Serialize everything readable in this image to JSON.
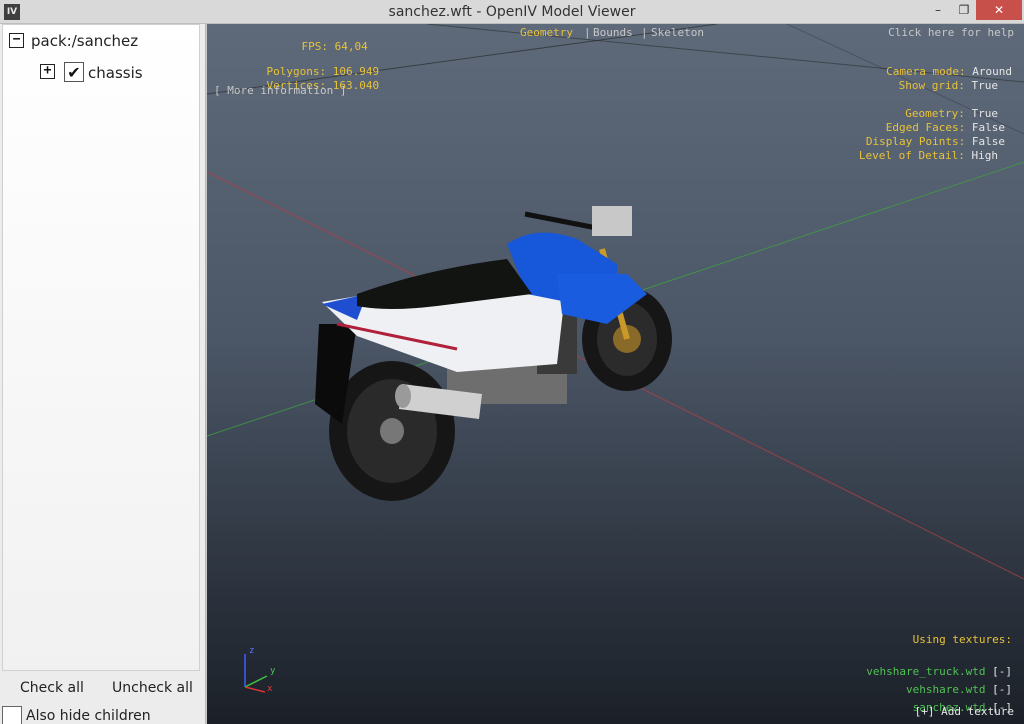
{
  "window": {
    "title": "sanchez.wft - OpenIV Model Viewer",
    "app_icon": "IV",
    "controls": {
      "minimize": "–",
      "maximize": "❐",
      "close": "✕"
    }
  },
  "tree": {
    "root": {
      "expander": "−",
      "label": "pack:/sanchez"
    },
    "child": {
      "expander": "+",
      "checked": "✔",
      "label": "chassis"
    }
  },
  "buttons": {
    "check_all": "Check all",
    "uncheck_all": "Uncheck all"
  },
  "also_hide_children": "Also hide children",
  "hud": {
    "fps": {
      "label": "FPS:",
      "value": "64,04"
    },
    "polygons": {
      "label": "Polygons:",
      "value": "106.949"
    },
    "vertices": {
      "label": "Vertices:",
      "value": "163.040"
    },
    "more_info": "[ More information ]",
    "modes": [
      "Geometry",
      "Bounds",
      "Skeleton"
    ],
    "mode_sep": "|",
    "help": "Click here for help",
    "camera_mode": {
      "label": "Camera mode:",
      "value": "Around"
    },
    "show_grid": {
      "label": "Show grid:",
      "value": "True"
    },
    "geometry": {
      "label": "Geometry:",
      "value": "True"
    },
    "edged_faces": {
      "label": "Edged Faces:",
      "value": "False"
    },
    "display_points": {
      "label": "Display Points:",
      "value": "False"
    },
    "lod": {
      "label": "Level of Detail:",
      "value": "High"
    },
    "using_textures": "Using textures:",
    "textures": [
      {
        "name": "vehshare_truck.wtd",
        "action": "[-]"
      },
      {
        "name": "vehshare.wtd",
        "action": "[-]"
      },
      {
        "name": "sanchez.wtd",
        "action": "[-]"
      }
    ],
    "add_texture": "[+] Add texture",
    "axes": {
      "z": "z",
      "y": "y",
      "x": "x"
    }
  },
  "colors": {
    "hud_yellow": "#e8c23a",
    "hud_green": "#4fc254",
    "close_red": "#c7504a"
  }
}
